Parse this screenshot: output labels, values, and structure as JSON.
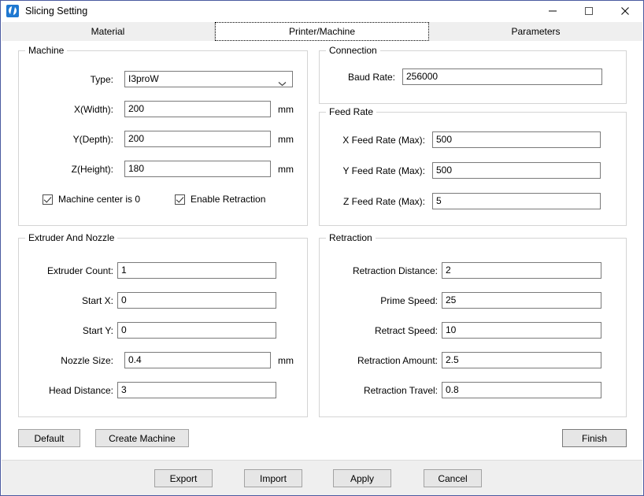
{
  "window": {
    "title": "Slicing Setting",
    "app_icon": "printer-app-icon",
    "controls": {
      "minimize": "minimize-icon",
      "maximize": "maximize-icon",
      "close": "close-icon"
    }
  },
  "tabs": [
    {
      "label": "Material",
      "selected": false
    },
    {
      "label": "Printer/Machine",
      "selected": true
    },
    {
      "label": "Parameters",
      "selected": false
    }
  ],
  "groups": {
    "machine": {
      "title": "Machine",
      "fields": [
        {
          "label": "Type:",
          "value": "I3proW",
          "unit": "",
          "control": "combobox"
        },
        {
          "label": "X(Width):",
          "value": "200",
          "unit": "mm",
          "control": "textbox"
        },
        {
          "label": "Y(Depth):",
          "value": "200",
          "unit": "mm",
          "control": "textbox"
        },
        {
          "label": "Z(Height):",
          "value": "180",
          "unit": "mm",
          "control": "textbox"
        }
      ],
      "checkboxes": [
        {
          "label": "Machine center is 0",
          "checked": true
        },
        {
          "label": "Enable Retraction",
          "checked": true
        }
      ]
    },
    "connection": {
      "title": "Connection",
      "fields": [
        {
          "label": "Baud Rate:",
          "value": "256000",
          "unit": "",
          "control": "textbox"
        }
      ]
    },
    "feed_rate": {
      "title": "Feed Rate",
      "fields": [
        {
          "label": "X Feed Rate (Max):",
          "value": "500",
          "unit": "",
          "control": "textbox"
        },
        {
          "label": "Y Feed Rate (Max):",
          "value": "500",
          "unit": "",
          "control": "textbox"
        },
        {
          "label": "Z Feed Rate (Max):",
          "value": "5",
          "unit": "",
          "control": "textbox"
        }
      ]
    },
    "extruder_and_nozzle": {
      "title": "Extruder And Nozzle",
      "fields": [
        {
          "label": "Extruder Count:",
          "value": "1",
          "unit": "",
          "control": "textbox"
        },
        {
          "label": "Start X:",
          "value": "0",
          "unit": "",
          "control": "textbox"
        },
        {
          "label": "Start Y:",
          "value": "0",
          "unit": "",
          "control": "textbox"
        },
        {
          "label": "Nozzle Size:",
          "value": "0.4",
          "unit": "mm",
          "control": "textbox"
        },
        {
          "label": "Head Distance:",
          "value": "3",
          "unit": "",
          "control": "textbox"
        }
      ]
    },
    "retraction": {
      "title": "Retraction",
      "fields": [
        {
          "label": "Retraction Distance:",
          "value": "2",
          "unit": "",
          "control": "textbox"
        },
        {
          "label": "Prime Speed:",
          "value": "25",
          "unit": "",
          "control": "textbox"
        },
        {
          "label": "Retract Speed:",
          "value": "10",
          "unit": "",
          "control": "textbox"
        },
        {
          "label": "Retraction Amount:",
          "value": "2.5",
          "unit": "",
          "control": "textbox"
        },
        {
          "label": "Retraction Travel:",
          "value": "0.8",
          "unit": "",
          "control": "textbox"
        }
      ]
    }
  },
  "action_buttons": {
    "default": "Default",
    "create_machine": "Create Machine",
    "finish": "Finish"
  },
  "footer_buttons": [
    {
      "label": "Export"
    },
    {
      "label": "Import"
    },
    {
      "label": "Apply"
    },
    {
      "label": "Cancel"
    }
  ],
  "colors": {
    "window_border": "#4a5aa0",
    "tab_strip_bg": "#efefef",
    "footer_bg": "#efefef",
    "group_border": "#d4d4d4",
    "input_border": "#7a7a7a",
    "button_face": "#e6e6e6",
    "text": "#000000"
  }
}
